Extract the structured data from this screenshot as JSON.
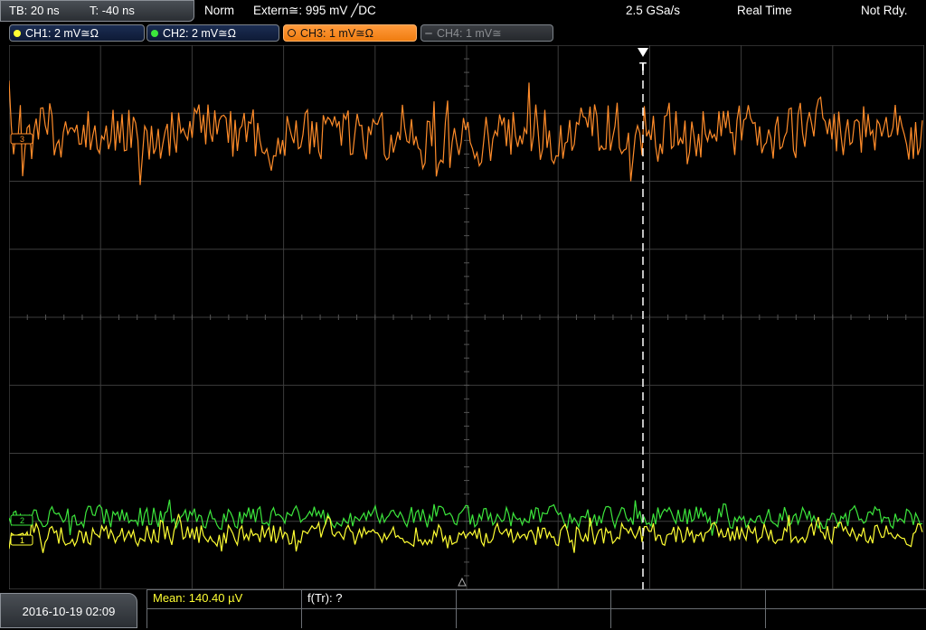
{
  "topbar": {
    "tb": "TB: 20 ns",
    "t": "T: -40 ns",
    "mode": "Norm",
    "trigger": "Extern≅: 995 mV ╱DC",
    "sample_rate": "2.5 GSa/s",
    "acq_mode": "Real Time",
    "status": "Not Rdy."
  },
  "channels": [
    {
      "label": "CH1: 2 mV≅Ω",
      "color": "#ffff33",
      "state": "normal"
    },
    {
      "label": "CH2: 2 mV≅Ω",
      "color": "#3ce63c",
      "state": "normal"
    },
    {
      "label": "CH3: 1 mV≅Ω",
      "color": "#ff8c2a",
      "state": "active"
    },
    {
      "label": "CH4: 1 mV≅",
      "color": "#7d7d7d",
      "state": "disabled"
    }
  ],
  "markers": {
    "ch3": "3",
    "ch2": "2",
    "ch1": "1",
    "trigger": "T"
  },
  "bottombar": {
    "datetime": "2016-10-19 02:09",
    "mean": "Mean: 140.40 µV",
    "ftr": "f(Tr): ?"
  },
  "colors": {
    "ch1": "#ffff33",
    "ch2": "#3ce63c",
    "ch3": "#ff8c2a",
    "grid": "#4a4a4a"
  }
}
